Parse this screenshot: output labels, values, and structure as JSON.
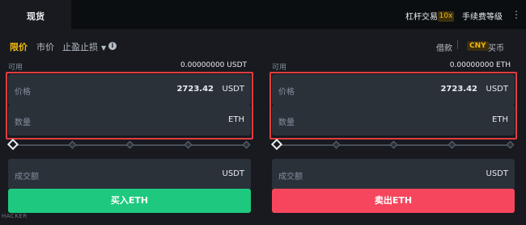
{
  "header": {
    "tab_active": "现货",
    "margin_trading": "杠杆交易",
    "leverage": "10x",
    "fee_level": "手续费等级",
    "menu_icon": "kebab-icon"
  },
  "order_types": {
    "limit": "限价",
    "market": "市价",
    "stop": "止盈止损",
    "info_icon": "info-icon"
  },
  "right_tools": {
    "borrow": "借款",
    "currency": "CNY",
    "buy_coin": "买币"
  },
  "buy": {
    "available_label": "可用",
    "available_value": "0.00000000 USDT",
    "price_label": "价格",
    "price_value": "2723.42",
    "price_unit": "USDT",
    "qty_label": "数量",
    "qty_unit": "ETH",
    "total_label": "成交额",
    "total_unit": "USDT",
    "button": "买入ETH",
    "slider_percent": 0
  },
  "sell": {
    "available_label": "可用",
    "available_value": "0.00000000 ETH",
    "price_label": "价格",
    "price_value": "2723.42",
    "price_unit": "USDT",
    "qty_label": "数量",
    "qty_unit": "ETH",
    "total_label": "成交额",
    "total_unit": "USDT",
    "button": "卖出ETH",
    "slider_percent": 0
  },
  "colors": {
    "accent": "#f0b90b",
    "buy": "#1ec97f",
    "sell": "#f6465d",
    "highlight": "#e23d3d",
    "background": "#181a20",
    "field": "#2b3139"
  },
  "watermark": "HACKER"
}
